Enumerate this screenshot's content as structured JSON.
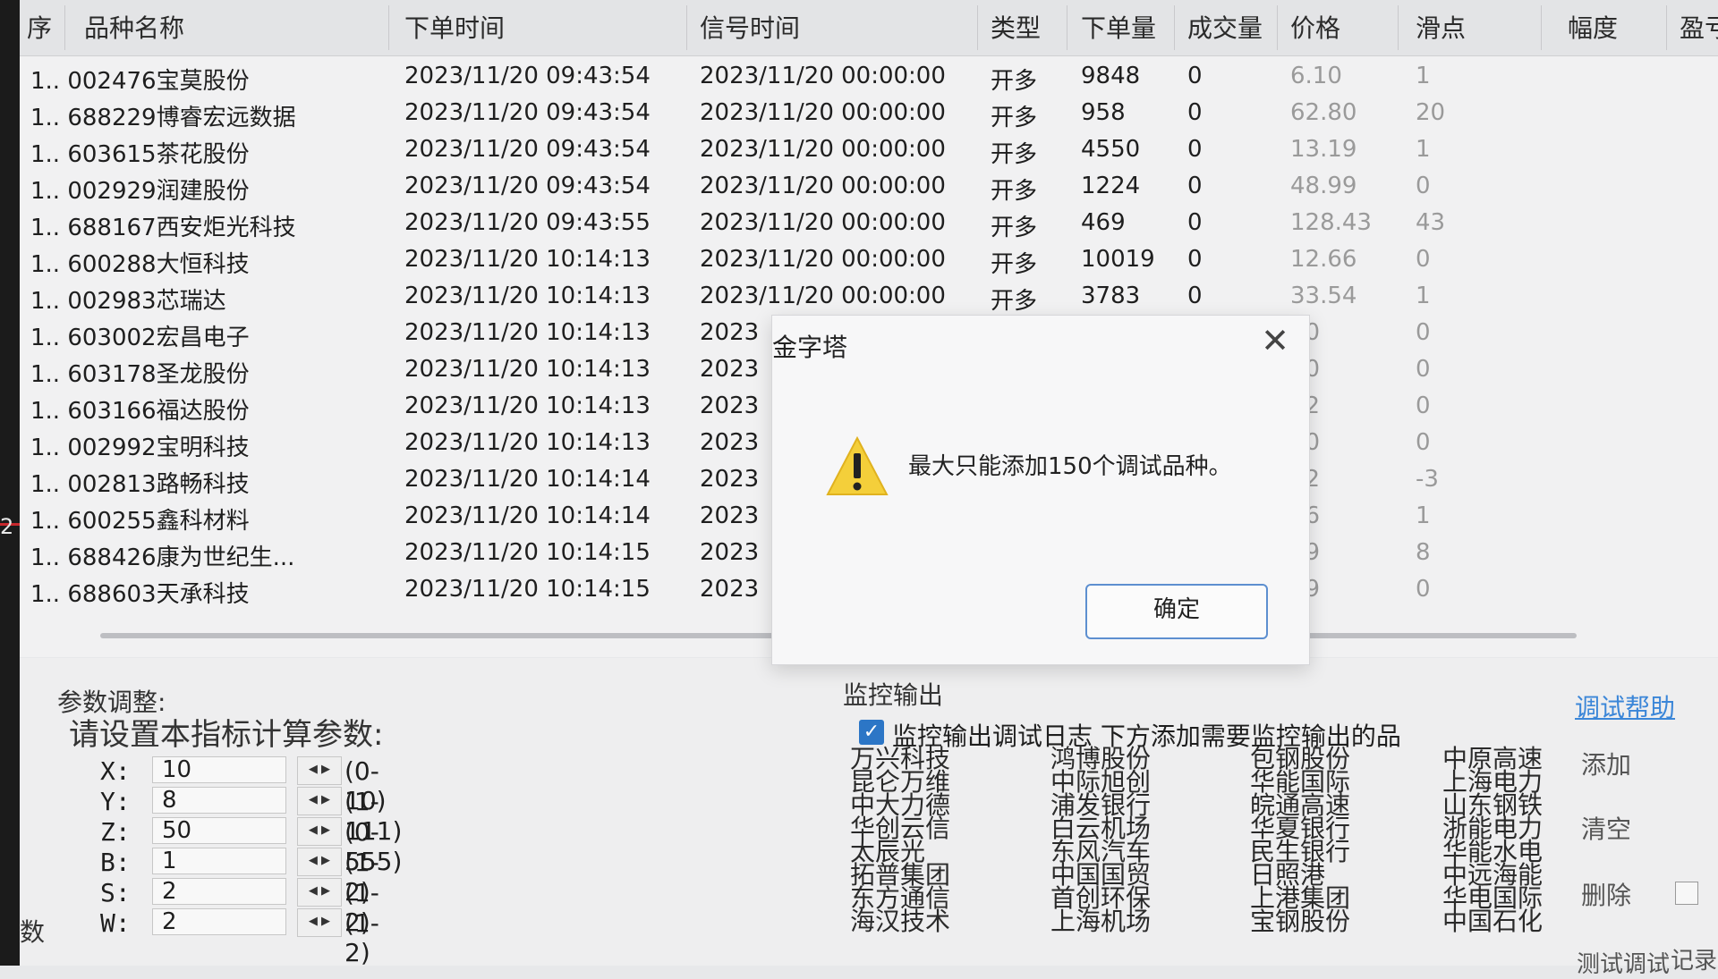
{
  "table": {
    "headers": [
      "序",
      "品种名称",
      "下单时间",
      "信号时间",
      "类型",
      "下单量",
      "成交量",
      "价格",
      "滑点",
      "幅度",
      "盈亏"
    ],
    "rows": [
      {
        "name": "1.. 002476宝莫股份",
        "order_time": "2023/11/20 09:43:54",
        "signal_time": "2023/11/20 00:00:00",
        "type": "开多",
        "qty": "9848",
        "deal": "0",
        "price": "6.10",
        "slip": "1"
      },
      {
        "name": "1.. 688229博睿宏远数据",
        "order_time": "2023/11/20 09:43:54",
        "signal_time": "2023/11/20 00:00:00",
        "type": "开多",
        "qty": "958",
        "deal": "0",
        "price": "62.80",
        "slip": "20"
      },
      {
        "name": "1.. 603615茶花股份",
        "order_time": "2023/11/20 09:43:54",
        "signal_time": "2023/11/20 00:00:00",
        "type": "开多",
        "qty": "4550",
        "deal": "0",
        "price": "13.19",
        "slip": "1"
      },
      {
        "name": "1.. 002929润建股份",
        "order_time": "2023/11/20 09:43:54",
        "signal_time": "2023/11/20 00:00:00",
        "type": "开多",
        "qty": "1224",
        "deal": "0",
        "price": "48.99",
        "slip": "0"
      },
      {
        "name": "1.. 688167西安炬光科技",
        "order_time": "2023/11/20 09:43:55",
        "signal_time": "2023/11/20 00:00:00",
        "type": "开多",
        "qty": "469",
        "deal": "0",
        "price": "128.43",
        "slip": "43"
      },
      {
        "name": "1.. 600288大恒科技",
        "order_time": "2023/11/20 10:14:13",
        "signal_time": "2023/11/20 00:00:00",
        "type": "开多",
        "qty": "10019",
        "deal": "0",
        "price": "12.66",
        "slip": "0"
      },
      {
        "name": "1.. 002983芯瑞达",
        "order_time": "2023/11/20 10:14:13",
        "signal_time": "2023/11/20 00:00:00",
        "type": "开多",
        "qty": "3783",
        "deal": "0",
        "price": "33.54",
        "slip": "1"
      },
      {
        "name": "1.. 603002宏昌电子",
        "order_time": "2023/11/20 10:14:13",
        "signal_time": "2023",
        "type": "",
        "qty": "",
        "deal": "",
        "price": "30",
        "slip": "0"
      },
      {
        "name": "1.. 603178圣龙股份",
        "order_time": "2023/11/20 10:14:13",
        "signal_time": "2023",
        "type": "",
        "qty": "",
        "deal": "",
        "price": "30",
        "slip": "0"
      },
      {
        "name": "1.. 603166福达股份",
        "order_time": "2023/11/20 10:14:13",
        "signal_time": "2023",
        "type": "",
        "qty": "",
        "deal": "",
        "price": "32",
        "slip": "0"
      },
      {
        "name": "1.. 002992宝明科技",
        "order_time": "2023/11/20 10:14:13",
        "signal_time": "2023",
        "type": "",
        "qty": "",
        "deal": "",
        "price": "80",
        "slip": "0"
      },
      {
        "name": "1.. 002813路畅科技",
        "order_time": "2023/11/20 10:14:14",
        "signal_time": "2023",
        "type": "",
        "qty": "",
        "deal": "",
        "price": "82",
        "slip": "-3"
      },
      {
        "name": "1.. 600255鑫科材料",
        "order_time": "2023/11/20 10:14:14",
        "signal_time": "2023",
        "type": "",
        "qty": "",
        "deal": "",
        "price": "26",
        "slip": "1"
      },
      {
        "name": "1.. 688426康为世纪生...",
        "order_time": "2023/11/20 10:14:15",
        "signal_time": "2023",
        "type": "",
        "qty": "",
        "deal": "",
        "price": "59",
        "slip": "8"
      },
      {
        "name": "1.. 688603天承科技",
        "order_time": "2023/11/20 10:14:15",
        "signal_time": "2023",
        "type": "",
        "qty": "",
        "deal": "",
        "price": "99",
        "slip": "0"
      }
    ]
  },
  "left_strip": {
    "label": "2"
  },
  "params": {
    "section_title": "参数调整:",
    "prompt": "请设置本指标计算参数:",
    "items": [
      {
        "key": "X:",
        "value": "10",
        "range": "(0-10)"
      },
      {
        "key": "Y:",
        "value": "8",
        "range": "(1-111)"
      },
      {
        "key": "Z:",
        "value": "50",
        "range": "(0-555)"
      },
      {
        "key": "B:",
        "value": "1",
        "range": "(1-2)"
      },
      {
        "key": "S:",
        "value": "2",
        "range": "(1-2)"
      },
      {
        "key": "W:",
        "value": "2",
        "range": "(1-2)"
      }
    ],
    "bottom_char": "数"
  },
  "monitor": {
    "title": "监控输出",
    "checkbox_label": "监控输出调试日志 下方添加需要监控输出的品",
    "help_link": "调试帮助",
    "col1": [
      "万兴科技",
      "昆仑万维",
      "中大力德",
      "华创云信",
      "太辰光",
      "拓普集团",
      "东方通信",
      "海汉技术"
    ],
    "col2": [
      "鸿博股份",
      "中际旭创",
      "浦发银行",
      "白云机场",
      "东风汽车",
      "中国国贸",
      "首创环保",
      "上海机场"
    ],
    "col3": [
      "包钢股份",
      "华能国际",
      "皖通高速",
      "华夏银行",
      "民生银行",
      "日照港",
      "上港集团",
      "宝钢股份"
    ],
    "col4": [
      "中原高速",
      "上海电力",
      "山东钢铁",
      "浙能电力",
      "华能水电",
      "中远海能",
      "华电国际",
      "中国石化"
    ],
    "buttons": {
      "add": "添加",
      "clear": "清空",
      "delete": "删除"
    },
    "bottom_left": "测试调试",
    "bottom_right": "记录"
  },
  "dialog": {
    "title": "金字塔",
    "close": "✕",
    "message": "最大只能添加150个调试品种。",
    "ok": "确定"
  }
}
